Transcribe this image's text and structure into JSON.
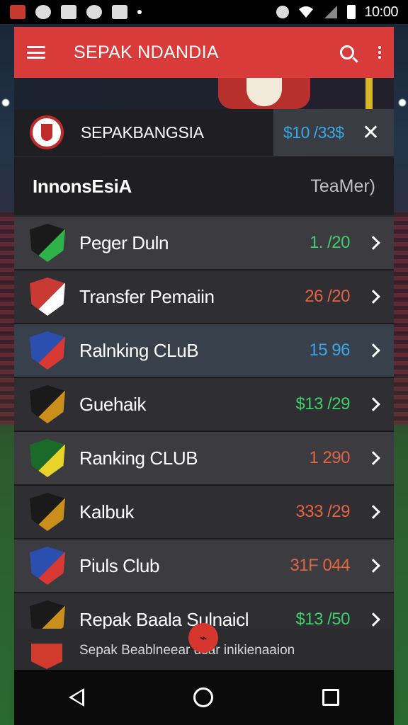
{
  "status_bar": {
    "time": "10:00",
    "icons": [
      "notification-icon",
      "sync-icon",
      "tag-icon",
      "smile-icon",
      "image-icon",
      "dot-icon",
      "alarm-icon",
      "wifi-icon",
      "signal-icon",
      "battery-icon"
    ]
  },
  "app_bar": {
    "title": "SEPAK NDANDIA",
    "menu_icon": "menu-icon",
    "search_icon": "search-icon",
    "more_icon": "more-vert-icon",
    "color": "#d93a3a"
  },
  "featured": {
    "club_name": "SEPAKBANGSIA",
    "price": "$10 /33$",
    "close_icon": "close-icon"
  },
  "section": {
    "title": "InnonsEsiA",
    "right_label": "TeaMer)"
  },
  "items": [
    {
      "label": "Peger Duln",
      "value": "1. /20",
      "color": "#3fce6a",
      "shield": "#1a1a1a",
      "accent": "#2fb24a"
    },
    {
      "label": "Transfer Pemaiin",
      "value": "26 /20",
      "color": "#e06543",
      "shield": "#c83a33",
      "accent": "#ffffff"
    },
    {
      "label": "Ralnking CLuB",
      "value": "15   96",
      "color": "#38a9e8",
      "shield": "#2a4fae",
      "accent": "#d83a33"
    },
    {
      "label": "Guehaik",
      "value": "$13 /29",
      "color": "#3fce6a",
      "shield": "#1a1a1a",
      "accent": "#c98f1a"
    },
    {
      "label": "Ranking CLUB",
      "value": "1   290",
      "color": "#e06543",
      "shield": "#1b6a2a",
      "accent": "#e9d22a"
    },
    {
      "label": "Kalbuk",
      "value": "333 /29",
      "color": "#e06543",
      "shield": "#1a1a1a",
      "accent": "#c98f1a"
    },
    {
      "label": "Piuls Club",
      "value": "31F 044",
      "color": "#e06543",
      "shield": "#2a4fae",
      "accent": "#d83a33"
    },
    {
      "label": "Repak Baala Sulnaicl",
      "value": "$13 /50",
      "color": "#3fce6a",
      "shield": "#1a1a1a",
      "accent": "#c98f1a"
    }
  ],
  "footer": {
    "text": "Sepak Beablneear dsar inikienaaion"
  },
  "nav": {
    "back_icon": "back-icon",
    "home_icon": "home-icon",
    "recent_icon": "recent-apps-icon"
  }
}
